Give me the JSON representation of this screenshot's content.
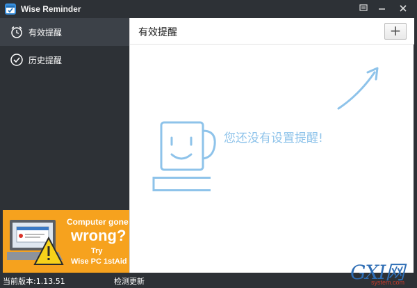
{
  "window": {
    "title": "Wise Reminder",
    "icons": {
      "app": "calendar-check-icon",
      "menu": "menu-icon",
      "minimize": "minimize-icon",
      "close": "close-icon"
    }
  },
  "sidebar": {
    "items": [
      {
        "label": "有效提醒",
        "icon": "alarm-clock-icon",
        "active": true
      },
      {
        "label": "历史提醒",
        "icon": "check-circle-icon",
        "active": false
      }
    ]
  },
  "ad": {
    "line1": "Computer gone",
    "line2": "wrong?",
    "line3": "Try",
    "line4": "Wise PC 1stAid",
    "colors": {
      "background": "#f6a21e",
      "text": "#ffffff"
    }
  },
  "main": {
    "title": "有效提醒",
    "add_label": "+",
    "empty_message": "您还没有设置提醒!",
    "illustration": "coffee-cup-smile-icon"
  },
  "statusbar": {
    "version": "当前版本:1.13.51",
    "check_update": "检测更新"
  },
  "watermark": {
    "logo": "GXI网",
    "domain": "system.com"
  },
  "colors": {
    "dark_bg": "#2d3136",
    "active_item": "#3c4148",
    "accent_light_blue": "#8ec3ea",
    "main_bg": "#ffffff"
  }
}
